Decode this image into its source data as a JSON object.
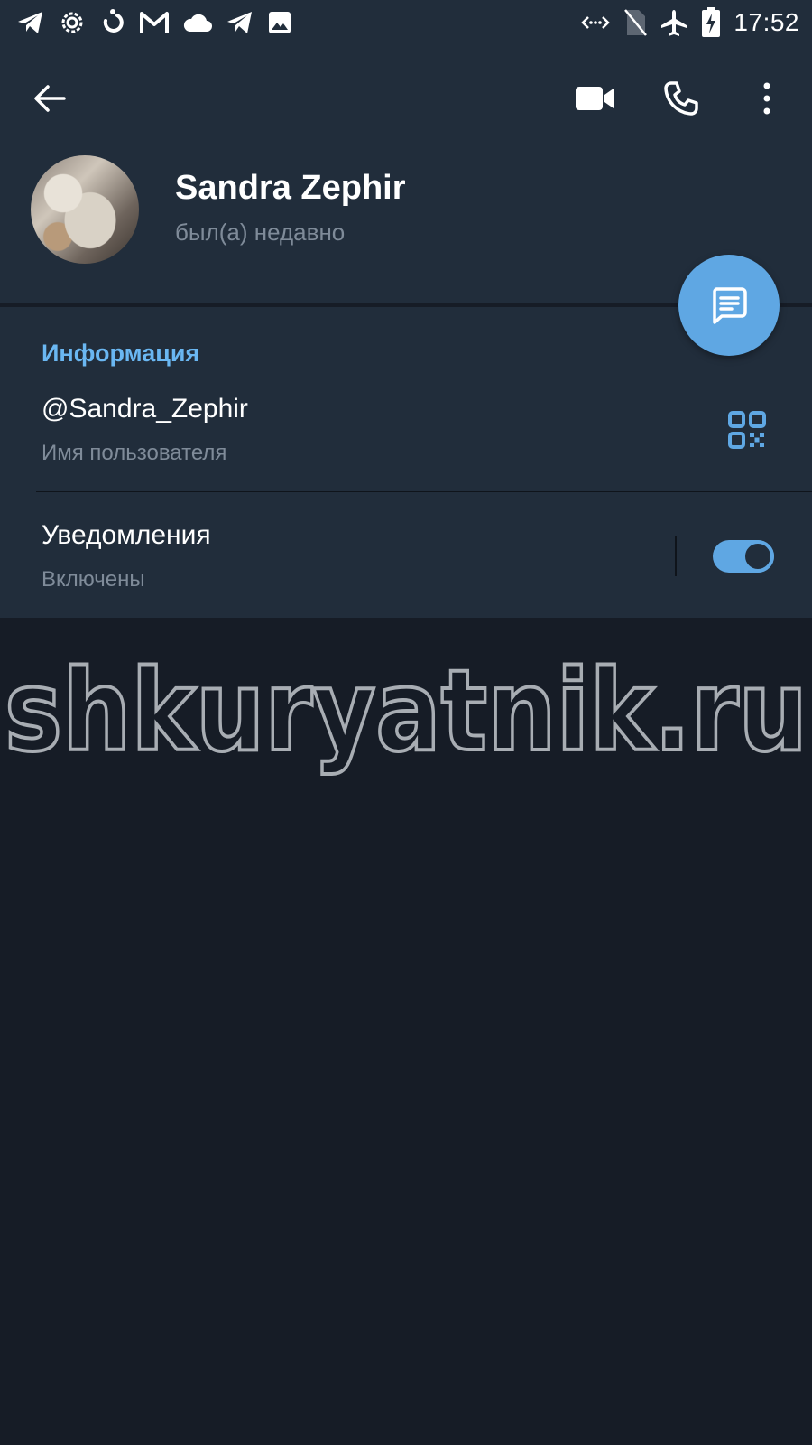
{
  "status_bar": {
    "time": "17:52",
    "left_icons": [
      "telegram-icon",
      "settings-gear-icon",
      "refresh-icon",
      "gmail-icon",
      "cloud-icon",
      "telegram-icon",
      "image-icon"
    ],
    "right_icons": [
      "data-saver-icon",
      "no-sim-icon",
      "airplane-mode-icon",
      "battery-charging-icon"
    ]
  },
  "header": {
    "actions": [
      "back-arrow-icon",
      "video-call-icon",
      "phone-call-icon",
      "more-vertical-icon"
    ]
  },
  "profile": {
    "name": "Sandra Zephir",
    "status": "был(а) недавно"
  },
  "info": {
    "section_title": "Информация",
    "username": "@Sandra_Zephir",
    "username_label": "Имя пользователя",
    "notifications_title": "Уведомления",
    "notifications_status": "Включены",
    "notifications_enabled": true
  },
  "watermark": {
    "text": "shkuryatnik.ru"
  },
  "colors": {
    "header_bg": "#212d3b",
    "page_bg": "#161c26",
    "accent": "#5fa7e3",
    "section_title": "#6ab7f2",
    "secondary_text": "#7f8b99"
  }
}
